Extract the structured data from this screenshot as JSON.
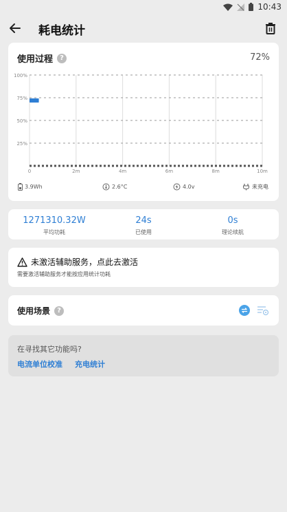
{
  "status": {
    "time": "10:43"
  },
  "header": {
    "title": "耗电统计"
  },
  "usage_card": {
    "title": "使用过程",
    "help": "?",
    "percent": "72%",
    "y_ticks": [
      "100%",
      "75%",
      "50%",
      "25%"
    ],
    "x_ticks": [
      "0",
      "2m",
      "4m",
      "6m",
      "8m",
      "10m"
    ],
    "stats": {
      "capacity": "3.9Wh",
      "temp": "2.6°C",
      "voltage": "4.0v",
      "charge": "未充电"
    }
  },
  "chart_data": {
    "type": "line",
    "title": "",
    "xlabel": "",
    "ylabel": "",
    "x_ticks": [
      "0",
      "2m",
      "4m",
      "6m",
      "8m",
      "10m"
    ],
    "y_ticks": [
      "100%",
      "75%",
      "50%",
      "25%"
    ],
    "xlim": [
      0,
      10
    ],
    "ylim": [
      0,
      100
    ],
    "grid": true,
    "series": [
      {
        "values": [
          [
            0,
            72
          ],
          [
            0.4,
            72
          ]
        ]
      }
    ],
    "accent": "#2f7fd4"
  },
  "metrics": [
    {
      "value": "1271310.32W",
      "label": "平均功耗"
    },
    {
      "value": "24s",
      "label": "已使用"
    },
    {
      "value": "0s",
      "label": "理论续航"
    }
  ],
  "accessibility": {
    "title": "未激活辅助服务，点此去激活",
    "subtitle": "需要激活辅助服务才能按应用统计功耗"
  },
  "scene": {
    "title": "使用场景",
    "help": "?"
  },
  "more": {
    "question": "在寻找其它功能吗?",
    "links": [
      "电流单位校准",
      "充电统计"
    ]
  },
  "colors": {
    "accent": "#2f7fd4",
    "background": "#ececec",
    "card": "#ffffff"
  },
  "icons": {
    "back": "arrow-left-icon",
    "delete": "trash-icon",
    "capacity": "battery-icon",
    "temp": "thermometer-icon",
    "voltage": "bolt-icon",
    "charge": "plug-icon",
    "warning": "warning-icon",
    "scene_1": "sync-icon",
    "scene_2": "list-settings-icon"
  }
}
